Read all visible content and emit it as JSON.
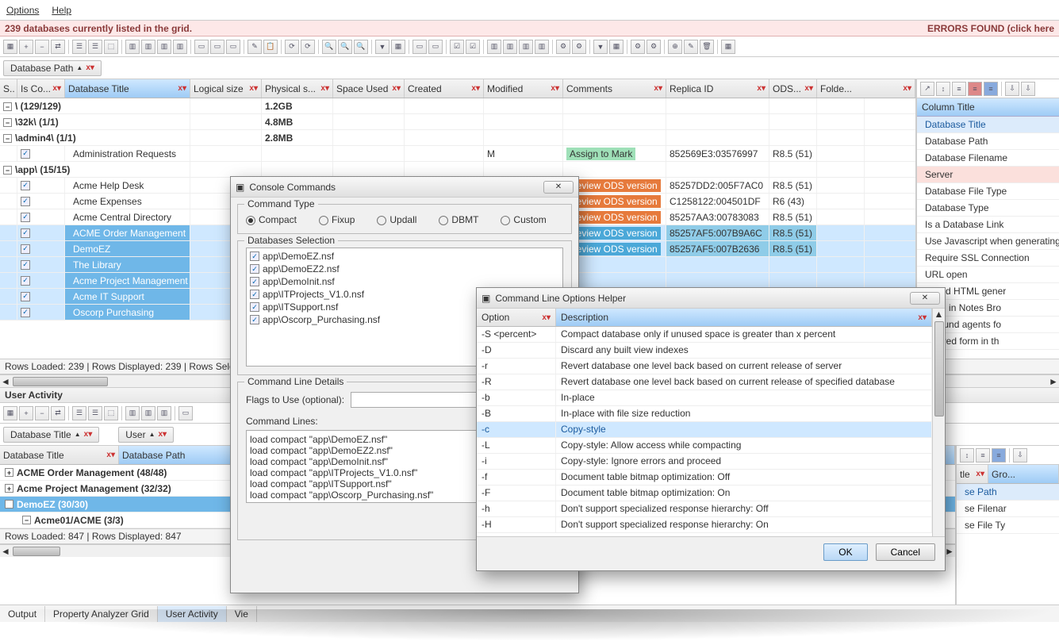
{
  "menu": {
    "options": "Options",
    "help": "Help"
  },
  "status_strip": {
    "left": "239 databases currently listed in the grid.",
    "right": "ERRORS FOUND (click here"
  },
  "grouping": {
    "chip": "Database Path",
    "sort_icon": "▲"
  },
  "columns": {
    "s": "S..",
    "iscon": "Is Co...",
    "title": "Database Title",
    "logical": "Logical size",
    "physical": "Physical s...",
    "space": "Space Used",
    "created": "Created",
    "modified": "Modified",
    "comments": "Comments",
    "replica": "Replica ID",
    "ods": "ODS...",
    "folder": "Folde..."
  },
  "groups": [
    {
      "label": "\\ (129/129)",
      "physical": "1.2GB"
    },
    {
      "label": "\\32k\\ (1/1)",
      "physical": "4.8MB"
    },
    {
      "label": "\\admin4\\ (1/1)",
      "physical": "2.8MB"
    },
    {
      "label": "\\app\\ (15/15)",
      "physical": ""
    }
  ],
  "row_admin": {
    "title": "Administration Requests",
    "comment": "Assign to Mark",
    "comment_style": "green",
    "replica": "852569E3:03576997",
    "ods": "R8.5 (51)"
  },
  "app_rows": [
    {
      "title": "Acme Help Desk",
      "comment": "Review ODS version",
      "cs": "orange",
      "replica": "85257DD2:005F7AC0",
      "ods": "R8.5 (51)"
    },
    {
      "title": "Acme Expenses",
      "comment": "Review ODS version",
      "cs": "orange",
      "replica": "C1258122:004501DF",
      "ods": "R6 (43)"
    },
    {
      "title": "Acme Central Directory",
      "comment": "Review ODS version",
      "cs": "orange",
      "replica": "85257AA3:00783083",
      "ods": "R8.5 (51)"
    },
    {
      "title": "ACME Order Management",
      "comment": "Review ODS version",
      "cs": "blue",
      "replica": "85257AF5:007B9A6C",
      "ods": "R8.5 (51)",
      "sel": true
    },
    {
      "title": "DemoEZ",
      "comment": "Review ODS version",
      "cs": "blue",
      "replica": "85257AF5:007B2636",
      "ods": "R8.5 (51)",
      "sel": true
    },
    {
      "title": "The Library",
      "sel": true
    },
    {
      "title": "Acme Project Management",
      "sel": true
    },
    {
      "title": "Acme IT Support",
      "sel": true
    },
    {
      "title": "Oscorp Purchasing",
      "sel": true
    }
  ],
  "grid_status": "Rows Loaded: 239  |  Rows Displayed: 239  |  Rows Sele",
  "right_panel": {
    "title": "Column Title",
    "items": [
      {
        "t": "Database Title",
        "hl": "blue"
      },
      {
        "t": "Database Path"
      },
      {
        "t": "Database Filename"
      },
      {
        "t": "Server",
        "hl": "pink"
      },
      {
        "t": "Database File Type"
      },
      {
        "t": "Database Type"
      },
      {
        "t": "Is a Database Link"
      },
      {
        "t": "Use Javascript when generating"
      },
      {
        "t": "Require SSL Connection"
      },
      {
        "t": "URL open"
      },
      {
        "t": "anced HTML gener"
      },
      {
        "t": "open in Notes Bro"
      },
      {
        "t": "kground agents fo"
      },
      {
        "t": "f stored form in th"
      }
    ]
  },
  "user_activity_title": "User Activity",
  "ua_grouping": {
    "chip1": "Database Title",
    "chip2": "User"
  },
  "ua_cols": {
    "title": "Database Title",
    "path": "Database Path",
    "right_tle": "tle",
    "right_gro": "Gro..."
  },
  "ua_rows": [
    {
      "toggle": "+",
      "label": "ACME Order Management (48/48)"
    },
    {
      "toggle": "+",
      "label": "Acme Project Management (32/32)"
    },
    {
      "toggle": "−",
      "label": "DemoEZ (30/30)",
      "sel": true
    },
    {
      "toggle": "−",
      "label": "Acme01/ACME (3/3)",
      "indent": true
    }
  ],
  "ua_right_rows": [
    "se Path",
    "se Filenar",
    "se File Ty"
  ],
  "ua_status": "Rows Loaded: 847  |  Rows Displayed: 847",
  "tabs": {
    "output": "Output",
    "prop": "Property Analyzer Grid",
    "ua": "User Activity",
    "vie": "Vie"
  },
  "console": {
    "title": "Console Commands",
    "ct_legend": "Command Type",
    "radios": {
      "compact": "Compact",
      "fixup": "Fixup",
      "updall": "Updall",
      "dbmt": "DBMT",
      "custom": "Custom"
    },
    "ds_legend": "Databases Selection",
    "dbs": [
      "app\\DemoEZ.nsf",
      "app\\DemoEZ2.nsf",
      "app\\DemoInit.nsf",
      "app\\ITProjects_V1.0.nsf",
      "app\\ITSupport.nsf",
      "app\\Oscorp_Purchasing.nsf"
    ],
    "cld_legend": "Command Line Details",
    "flags_label": "Flags to Use (optional):",
    "cl_label": "Command Lines:",
    "lines": [
      "load compact \"app\\DemoEZ.nsf\"",
      "load compact \"app\\DemoEZ2.nsf\"",
      "load compact \"app\\DemoInit.nsf\"",
      "load compact \"app\\ITProjects_V1.0.nsf\"",
      "load compact \"app\\ITSupport.nsf\"",
      "load compact \"app\\Oscorp_Purchasing.nsf\""
    ]
  },
  "helper": {
    "title": "Command Line Options Helper",
    "col_opt": "Option",
    "col_desc": "Description",
    "rows": [
      {
        "o": "-S <percent>",
        "d": "Compact database only if unused space is greater than x percent"
      },
      {
        "o": "-D",
        "d": "Discard any built view indexes"
      },
      {
        "o": "-r",
        "d": "Revert database one level back based on current release of server"
      },
      {
        "o": "-R",
        "d": "Revert database one level back based on current release of specified database"
      },
      {
        "o": "-b",
        "d": "In-place"
      },
      {
        "o": "-B",
        "d": "In-place with file size reduction"
      },
      {
        "o": "-c",
        "d": "Copy-style",
        "sel": true
      },
      {
        "o": "-L",
        "d": "Copy-style: Allow access while compacting"
      },
      {
        "o": "-i",
        "d": "Copy-style: Ignore errors and proceed"
      },
      {
        "o": "-f",
        "d": "Document table bitmap optimization: Off"
      },
      {
        "o": "-F",
        "d": "Document table bitmap optimization: On"
      },
      {
        "o": "-h",
        "d": "Don't support specialized response hierarchy: Off"
      },
      {
        "o": "-H",
        "d": "Don't support specialized response hierarchy: On"
      }
    ],
    "ok": "OK",
    "cancel": "Cancel"
  }
}
